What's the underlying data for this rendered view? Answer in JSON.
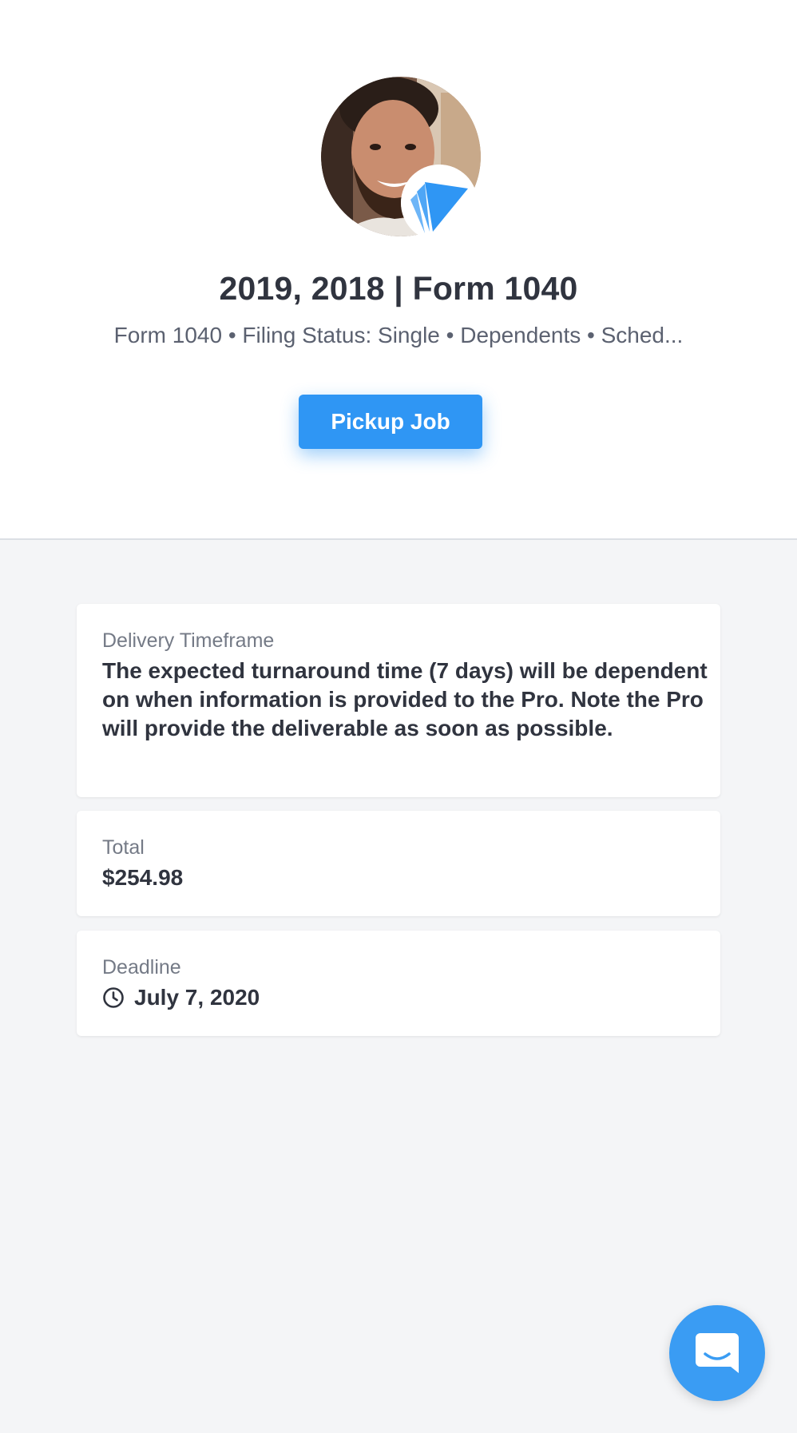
{
  "header": {
    "title": "2019, 2018 | Form 1040",
    "subtitle": "Form 1040 • Filing Status: Single • Dependents • Sched...",
    "pickup_label": "Pickup Job"
  },
  "icons": {
    "avatar": "user-avatar-photo",
    "badge": "brand-logo-icon",
    "clock": "clock-icon",
    "chat": "chat-bubble-icon"
  },
  "colors": {
    "accent": "#2f96f4",
    "background": "#f4f5f7",
    "card": "#ffffff",
    "text": "#30343f",
    "muted": "#747a86"
  },
  "cards": [
    {
      "label": "Delivery Timeframe",
      "value": "The expected turnaround time (7 days) will be dependent on when information is provided to the Pro. Note the Pro will provide the deliverable as soon as possible."
    },
    {
      "label": "Total",
      "value": "$254.98"
    },
    {
      "label": "Deadline",
      "value": "July 7, 2020"
    }
  ]
}
